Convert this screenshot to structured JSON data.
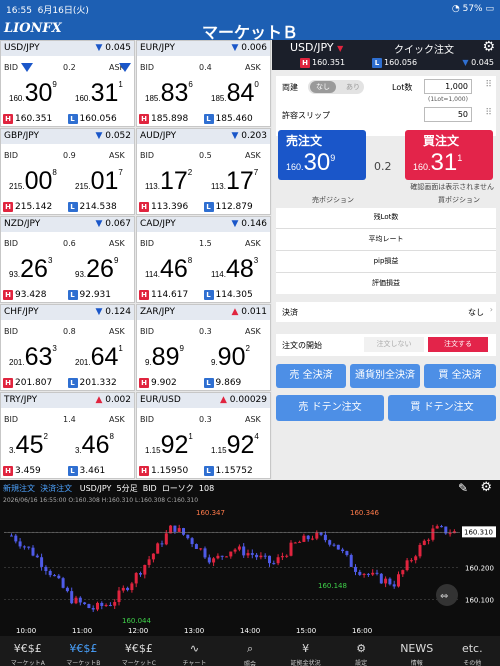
{
  "status": {
    "time": "16:55",
    "date": "6月16日(火)",
    "battery": "57%"
  },
  "header": {
    "logo": "LIONFX",
    "title": "マーケットＢ"
  },
  "tiles": [
    {
      "pair": "USD/JPY",
      "dir": "dn",
      "chg": "0.045",
      "spread": "0.2",
      "bid_pre": "160.",
      "bid": "30",
      "bid_sup": "9",
      "ask_pre": "160.",
      "ask": "31",
      "ask_sup": "1",
      "high": "160.351",
      "low": "160.056",
      "arrows": true
    },
    {
      "pair": "EUR/JPY",
      "dir": "dn",
      "chg": "0.006",
      "spread": "0.4",
      "bid_pre": "185.",
      "bid": "83",
      "bid_sup": "6",
      "ask_pre": "185.",
      "ask": "84",
      "ask_sup": "0",
      "high": "185.898",
      "low": "185.460"
    },
    {
      "pair": "GBP/JPY",
      "dir": "dn",
      "chg": "0.052",
      "spread": "0.9",
      "bid_pre": "215.",
      "bid": "00",
      "bid_sup": "8",
      "ask_pre": "215.",
      "ask": "01",
      "ask_sup": "7",
      "high": "215.142",
      "low": "214.538"
    },
    {
      "pair": "AUD/JPY",
      "dir": "dn",
      "chg": "0.203",
      "spread": "0.5",
      "bid_pre": "113.",
      "bid": "17",
      "bid_sup": "2",
      "ask_pre": "113.",
      "ask": "17",
      "ask_sup": "7",
      "high": "113.396",
      "low": "112.879"
    },
    {
      "pair": "NZD/JPY",
      "dir": "dn",
      "chg": "0.067",
      "spread": "0.6",
      "bid_pre": "93.",
      "bid": "26",
      "bid_sup": "3",
      "ask_pre": "93.",
      "ask": "26",
      "ask_sup": "9",
      "high": "93.428",
      "low": "92.931"
    },
    {
      "pair": "CAD/JPY",
      "dir": "dn",
      "chg": "0.146",
      "spread": "1.5",
      "bid_pre": "114.",
      "bid": "46",
      "bid_sup": "8",
      "ask_pre": "114.",
      "ask": "48",
      "ask_sup": "3",
      "high": "114.617",
      "low": "114.305"
    },
    {
      "pair": "CHF/JPY",
      "dir": "dn",
      "chg": "0.124",
      "spread": "0.8",
      "bid_pre": "201.",
      "bid": "63",
      "bid_sup": "3",
      "ask_pre": "201.",
      "ask": "64",
      "ask_sup": "1",
      "high": "201.807",
      "low": "201.332"
    },
    {
      "pair": "ZAR/JPY",
      "dir": "up",
      "chg": "0.011",
      "spread": "0.3",
      "bid_pre": "9.",
      "bid": "89",
      "bid_sup": "9",
      "ask_pre": "9.",
      "ask": "90",
      "ask_sup": "2",
      "high": "9.902",
      "low": "9.869"
    },
    {
      "pair": "TRY/JPY",
      "dir": "up",
      "chg": "0.002",
      "spread": "1.4",
      "bid_pre": "3.",
      "bid": "45",
      "bid_sup": "2",
      "ask_pre": "3.",
      "ask": "46",
      "ask_sup": "8",
      "high": "3.459",
      "low": "3.461"
    },
    {
      "pair": "EUR/USD",
      "dir": "up",
      "chg": "0.00029",
      "spread": "0.3",
      "bid_pre": "1.15",
      "bid": "92",
      "bid_sup": "1",
      "ask_pre": "1.15",
      "ask": "92",
      "ask_sup": "4",
      "high": "1.15950",
      "low": "1.15752"
    }
  ],
  "labels": {
    "bid": "BID",
    "ask": "ASK",
    "H": "H",
    "L": "L"
  },
  "order": {
    "pair": "USD/JPY",
    "mode": "クイック注文",
    "high": "160.351",
    "low": "160.056",
    "chg": "0.045",
    "ryodate": "両建",
    "nashi": "なし",
    "ari": "あり",
    "lot_label": "Lot数",
    "lot_value": "1,000",
    "lot_note": "(1Lot=1,000)",
    "slip_label": "許容スリップ",
    "slip_value": "50",
    "sell_label": "売注文",
    "sell_pre": "160.",
    "sell_big": "30",
    "sell_sup": "9",
    "buy_label": "買注文",
    "buy_pre": "160.",
    "buy_big": "31",
    "buy_sup": "1",
    "spread": "0.2",
    "confirm": "確認画面は表示されません",
    "sell_pos": "売ポジション",
    "buy_pos": "買ポジション",
    "info": [
      "残Lot数",
      "平均レート",
      "pip損益",
      "評価損益"
    ],
    "kessai": "決済",
    "kessai_val": "なし",
    "start": "注文の開始",
    "no_order": "注文しない",
    "do_order": "注文する",
    "buttons": [
      "売 全決済",
      "通貨別全決済",
      "買 全決済",
      "売 ドテン注文",
      "買 ドテン注文"
    ]
  },
  "chart_bar": {
    "new": "新規注文",
    "settle": "決済注文",
    "pair": "USD/JPY",
    "tf": "5分足",
    "side": "BID",
    "candle": "ローソク",
    "count": "108",
    "ohlc": "2026/06/16 16:55:00  O:160.308  H:160.310  L:160.308  C:160.310"
  },
  "chart_data": {
    "type": "candlestick",
    "x_ticks": [
      "10:00",
      "11:00",
      "12:00",
      "13:00",
      "14:00",
      "15:00",
      "16:00"
    ],
    "y_ticks": [
      "160.310",
      "160.200",
      "160.100"
    ],
    "annotations": [
      "160.347",
      "160.346",
      "160.148",
      "160.044"
    ],
    "current": "160.310",
    "ylim": [
      160.02,
      160.38
    ]
  },
  "tabs": [
    {
      "label": "マーケットA",
      "icon": "¥€$£"
    },
    {
      "label": "マーケットB",
      "icon": "¥€$£",
      "active": true
    },
    {
      "label": "マーケットC",
      "icon": "¥€$£"
    },
    {
      "label": "チャート",
      "icon": "∿"
    },
    {
      "label": "照会",
      "icon": "⌕"
    },
    {
      "label": "証拠金状況",
      "icon": "¥"
    },
    {
      "label": "設定",
      "icon": "⚙"
    },
    {
      "label": "情報",
      "icon": "NEWS"
    },
    {
      "label": "その他",
      "icon": "etc."
    }
  ]
}
